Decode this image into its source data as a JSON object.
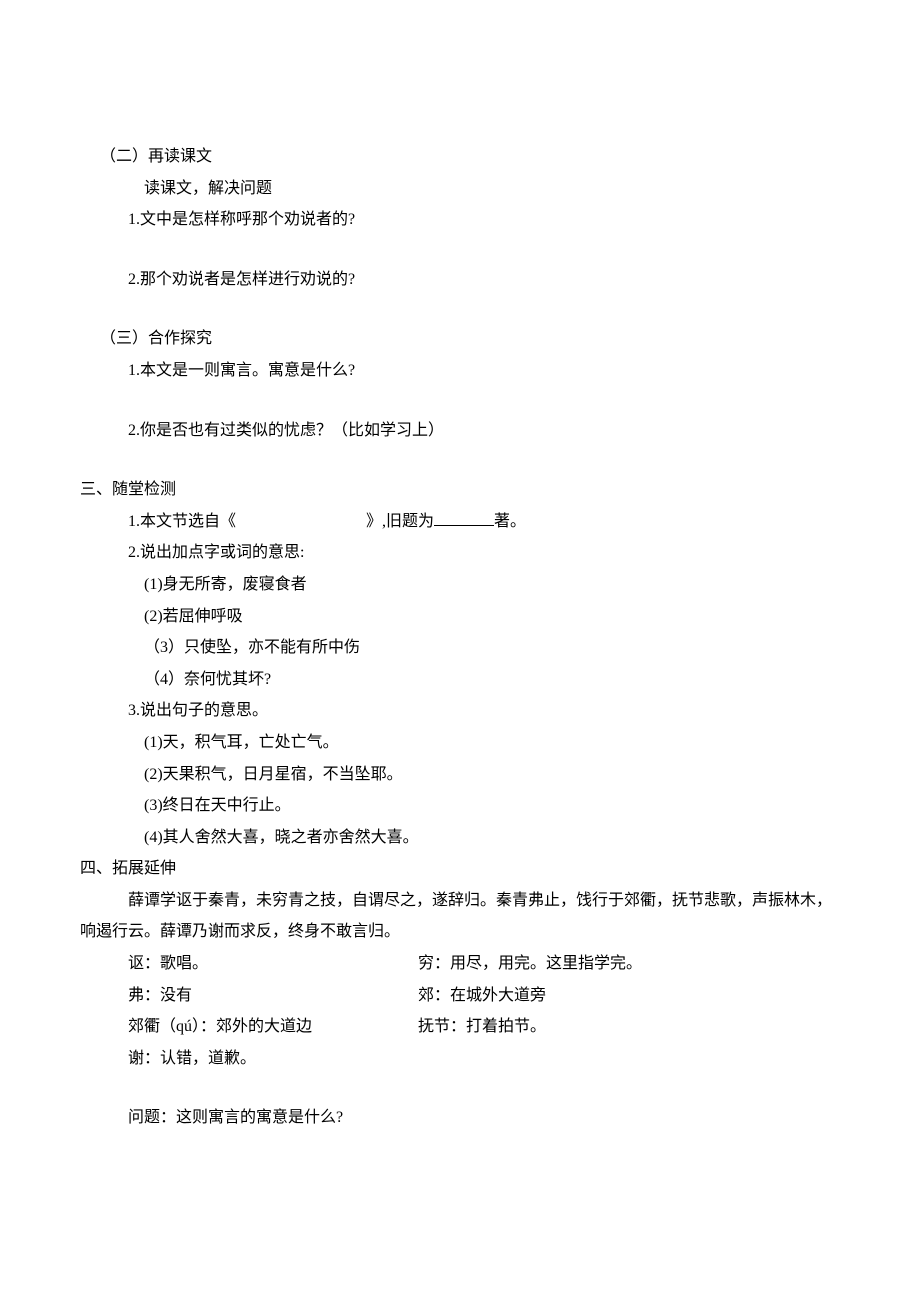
{
  "section2": {
    "title": "（二）再读课文",
    "subtitle": "读课文，解决问题",
    "q1": "1.文中是怎样称呼那个劝说者的?",
    "q2": "2.那个劝说者是怎样进行劝说的?"
  },
  "section3": {
    "title": "（三）合作探究",
    "q1": "1.本文是一则寓言。寓意是什么?",
    "q2": "2.你是否也有过类似的忧虑？（比如学习上）"
  },
  "part3_title": "三、随堂检测",
  "q1": {
    "prefix": "1.本文节选自《",
    "mid": "》,旧题为",
    "suffix": "著。"
  },
  "q2": {
    "title": "2.说出加点字或词的意思:",
    "a": "(1)身无所寄，废寝食者",
    "b": "(2)若屈伸呼吸",
    "c": "（3）只使坠，亦不能有所中伤",
    "d": "（4）奈何忧其坏?"
  },
  "q3": {
    "title": "3.说出句子的意思。",
    "a": "(1)天，积气耳，亡处亡气。",
    "b": "(2)天果积气，日月星宿，不当坠耶。",
    "c": "(3)终日在天中行止。",
    "d": "(4)其人舍然大喜，晓之者亦舍然大喜。"
  },
  "part4_title": "四、拓展延伸",
  "passage": {
    "line1": "薛谭学讴于秦青，未穷青之技，自谓尽之，遂辞归。秦青弗止，饯行于郊衢，抚节悲歌，声振林木，",
    "line2": "响遏行云。薛谭乃谢而求反，终身不敢言归。"
  },
  "vocab": {
    "ou_left": "讴：歌唱。",
    "ou_right": "穷：用尽，用完。这里指学完。",
    "fu_left": "弗：没有",
    "fu_right": "郊：在城外大道旁",
    "qu_left": "郊衢（qú）：郊外的大道边",
    "qu_right": "抚节：打着拍节。",
    "xie": "谢：认错，道歉。"
  },
  "question_final": "问题：这则寓言的寓意是什么?"
}
